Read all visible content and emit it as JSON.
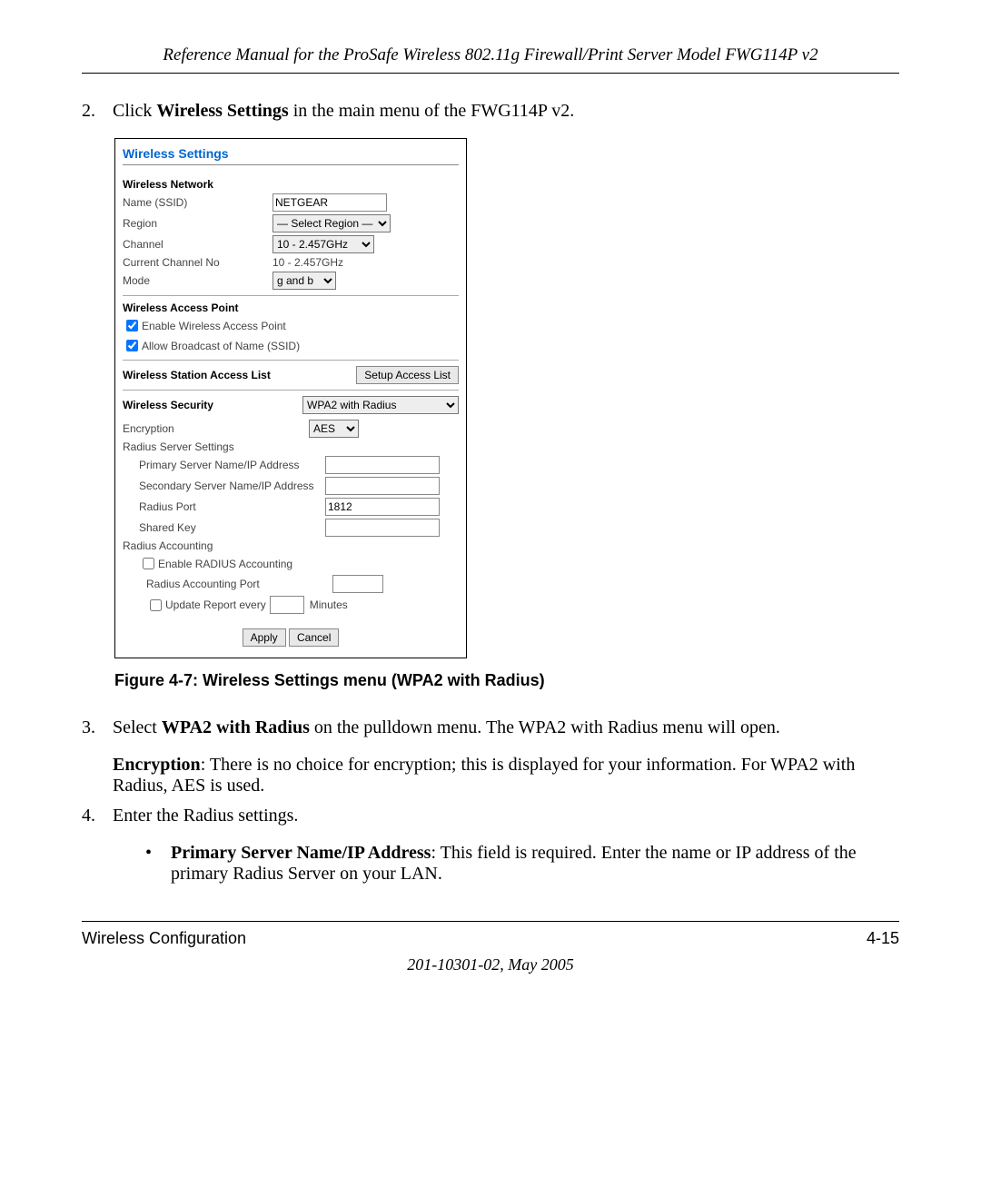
{
  "header": "Reference Manual for the ProSafe Wireless 802.11g  Firewall/Print Server Model FWG114P v2",
  "step2": {
    "num": "2.",
    "pre": "Click ",
    "bold": "Wireless Settings",
    "post": " in the main menu of the FWG114P v2."
  },
  "ui": {
    "title": "Wireless Settings",
    "wn_head": "Wireless Network",
    "name_label": "Name (SSID)",
    "name_value": "NETGEAR",
    "region_label": "Region",
    "region_value": "— Select Region —",
    "channel_label": "Channel",
    "channel_value": "10 - 2.457GHz",
    "curchan_label": "Current Channel No",
    "curchan_value": "10 - 2.457GHz",
    "mode_label": "Mode",
    "mode_value": "g and b",
    "wap_head": "Wireless Access Point",
    "enable_wap": "Enable Wireless Access Point",
    "allow_bcast": "Allow Broadcast of Name (SSID)",
    "wsal_head": "Wireless Station Access List",
    "setup_btn": "Setup Access List",
    "wsec_head": "Wireless Security",
    "wsec_value": "WPA2 with Radius",
    "enc_label": "Encryption",
    "enc_value": "AES",
    "rss_label": "Radius Server Settings",
    "primary_label": "Primary Server Name/IP Address",
    "secondary_label": "Secondary Server Name/IP Address",
    "radius_port_label": "Radius Port",
    "radius_port_value": "1812",
    "shared_key_label": "Shared Key",
    "ra_label": "Radius Accounting",
    "enable_ra": "Enable RADIUS Accounting",
    "ra_port_label": "Radius Accounting Port",
    "update_label": "Update Report every",
    "minutes": "Minutes",
    "apply": "Apply",
    "cancel": "Cancel"
  },
  "caption": "Figure 4-7:  Wireless Settings menu (WPA2 with Radius)",
  "step3": {
    "num": "3.",
    "pre": "Select ",
    "bold": "WPA2 with Radius",
    "post": " on the pulldown menu. The WPA2 with Radius menu will open.",
    "enc_bold": "Encryption",
    "enc_rest": ": There is no choice for encryption; this is displayed for your information. For WPA2 with Radius, AES is used."
  },
  "step4": {
    "num": "4.",
    "text": "Enter the Radius settings.",
    "bullet_bold": "Primary Server Name/IP Address",
    "bullet_rest": ": This field is required. Enter the name or IP address of the primary Radius Server on your LAN."
  },
  "footer": {
    "left": "Wireless Configuration",
    "right": "4-15",
    "center": "201-10301-02, May 2005"
  }
}
